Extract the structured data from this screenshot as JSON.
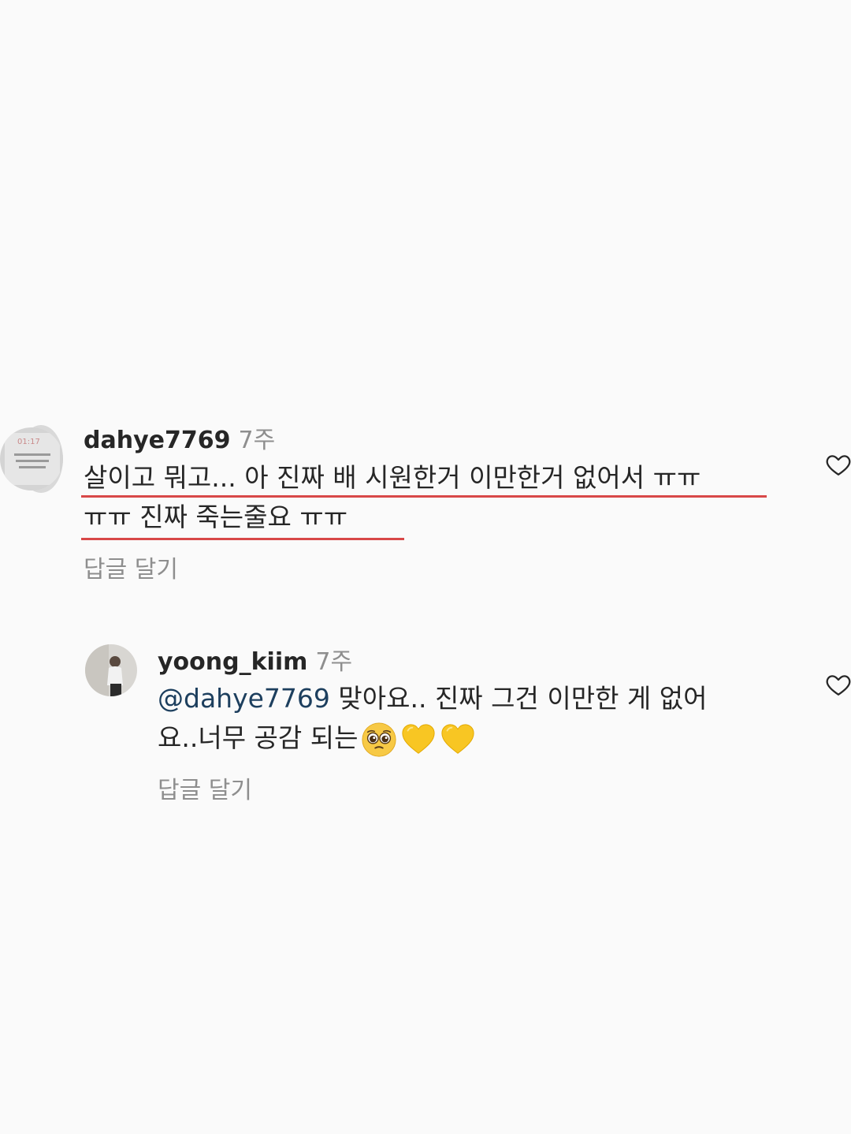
{
  "comments": [
    {
      "username": "dahye7769",
      "time": "7주",
      "line1": "살이고 뭐고... 아 진짜 배 시원한거 이만한거 없어서 ㅠㅠ",
      "line2": "ㅠㅠ 진짜 죽는줄요 ㅠㅠ",
      "reply_label": "답글 달기",
      "avatar_text": "01:17"
    },
    {
      "username": "yoong_kiim",
      "time": "7주",
      "mention": "@dahye7769",
      "line1_rest": " 맞아요.. 진짜 그건 이만한 게 없어",
      "line2": "요..너무 공감 되는",
      "reply_label": "답글 달기"
    }
  ],
  "colors": {
    "background": "#fafafa",
    "text": "#262626",
    "secondary": "#8e8e8e",
    "underline": "#d84848",
    "mention": "#1d3f5e"
  },
  "icons": [
    "heart-icon",
    "pleading-face-emoji",
    "yellow-heart-emoji"
  ]
}
